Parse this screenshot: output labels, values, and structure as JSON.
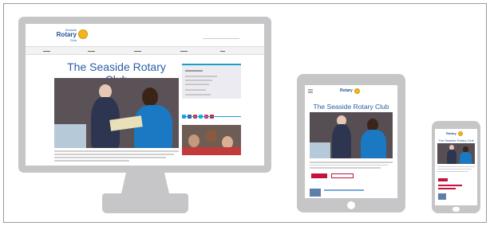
{
  "site": {
    "title": "The Seaside Rotary Club",
    "logo": {
      "line1": "Seaside",
      "line2": "Rotary",
      "line3": "Club",
      "emblem": "rotary-wheel-icon"
    }
  },
  "colors": {
    "device": "#c6c6c8",
    "title_blue": "#2b5da6",
    "accent_cyan": "#19a0c9",
    "button_red": "#c4123f",
    "rotary_gold": "#f2b61c"
  },
  "devices": [
    "desktop",
    "tablet",
    "phone"
  ]
}
